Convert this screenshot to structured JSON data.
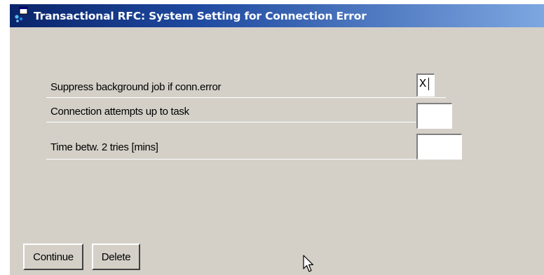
{
  "window": {
    "title": "Transactional RFC: System Setting for Connection Error"
  },
  "settings": [
    {
      "label": "Suppress background job if conn.error",
      "value": "X"
    },
    {
      "label": "Connection attempts up to task",
      "value": ""
    },
    {
      "label": "Time betw. 2 tries [mins]",
      "value": ""
    }
  ],
  "buttons": {
    "continue_label": "Continue",
    "delete_label": "Delete"
  },
  "icons": {
    "title": "sap-window-icon",
    "pointer": "mouse-pointer-icon"
  },
  "colors": {
    "titlebar_start": "#0a246a",
    "titlebar_end": "#7da7e0",
    "dialog_background": "#d4d0c8"
  }
}
